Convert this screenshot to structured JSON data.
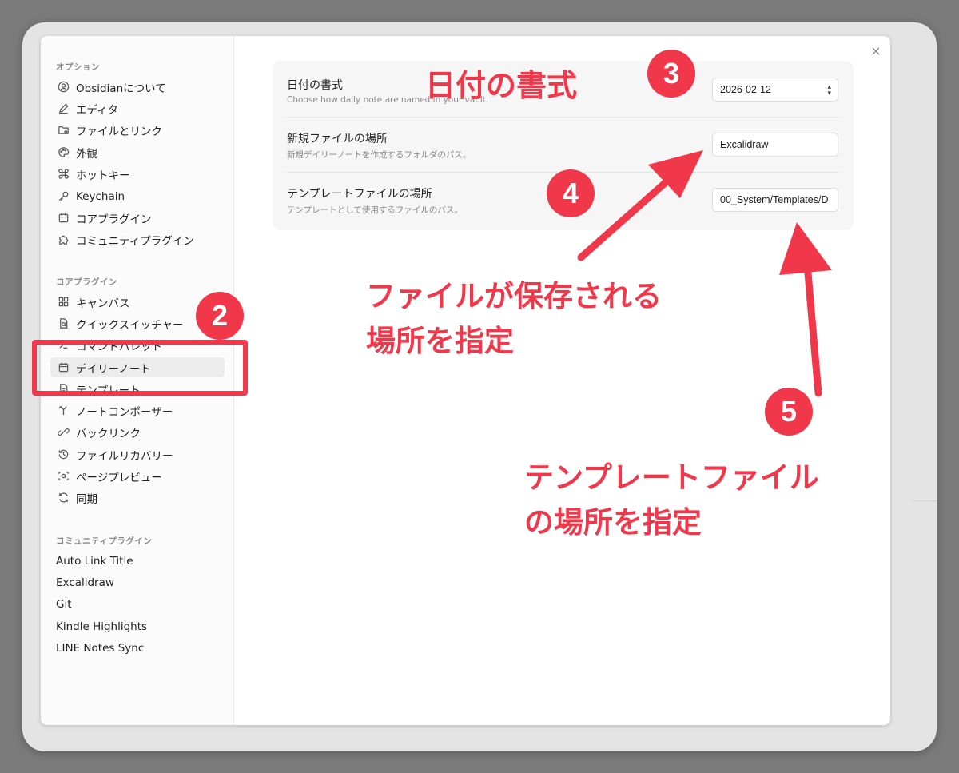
{
  "sidebar": {
    "options_title": "オプション",
    "options": [
      {
        "label": "Obsidianについて",
        "icon": "user-circle-icon"
      },
      {
        "label": "エディタ",
        "icon": "pencil-icon"
      },
      {
        "label": "ファイルとリンク",
        "icon": "folder-link-icon"
      },
      {
        "label": "外観",
        "icon": "palette-icon"
      },
      {
        "label": "ホットキー",
        "icon": "command-icon"
      },
      {
        "label": "Keychain",
        "icon": "key-icon"
      },
      {
        "label": "コアプラグイン",
        "icon": "calendar-box-icon"
      },
      {
        "label": "コミュニティプラグイン",
        "icon": "puzzle-icon"
      }
    ],
    "core_title": "コアプラグイン",
    "core": [
      {
        "label": "キャンバス",
        "icon": "canvas-icon"
      },
      {
        "label": "クイックスイッチャー",
        "icon": "quick-switcher-icon"
      },
      {
        "label": "コマンドパレット",
        "icon": "terminal-icon"
      },
      {
        "label": "デイリーノート",
        "icon": "calendar-icon"
      },
      {
        "label": "テンプレート",
        "icon": "template-icon"
      },
      {
        "label": "ノートコンポーザー",
        "icon": "merge-icon"
      },
      {
        "label": "バックリンク",
        "icon": "backlink-icon"
      },
      {
        "label": "ファイルリカバリー",
        "icon": "history-icon"
      },
      {
        "label": "ページプレビュー",
        "icon": "preview-icon"
      },
      {
        "label": "同期",
        "icon": "sync-icon"
      }
    ],
    "community_title": "コミュニティプラグイン",
    "community": [
      "Auto Link Title",
      "Excalidraw",
      "Git",
      "Kindle Highlights",
      "LINE Notes Sync"
    ]
  },
  "settings": {
    "date_format": {
      "name": "日付の書式",
      "desc": "Choose how daily note are named in your vault.",
      "value": "2026-02-12"
    },
    "new_file_location": {
      "name": "新規ファイルの場所",
      "desc": "新規デイリーノートを作成するフォルダのパス。",
      "value": "Excalidraw"
    },
    "template_location": {
      "name": "テンプレートファイルの場所",
      "desc": "テンプレートとして使用するファイルのパス。",
      "value": "00_System/Templates/D"
    }
  },
  "close_label": "×",
  "annotations": {
    "badge_2": "2",
    "badge_3": "3",
    "badge_4": "4",
    "badge_5": "5",
    "label_3": "日付の書式",
    "label_4_line1": "ファイルが保存される",
    "label_4_line2": "場所を指定",
    "label_5_line1": "テンプレートファイル",
    "label_5_line2": "の場所を指定"
  },
  "colors": {
    "annotation_red": "#f0384a",
    "background_gray": "#7a7a7a"
  }
}
